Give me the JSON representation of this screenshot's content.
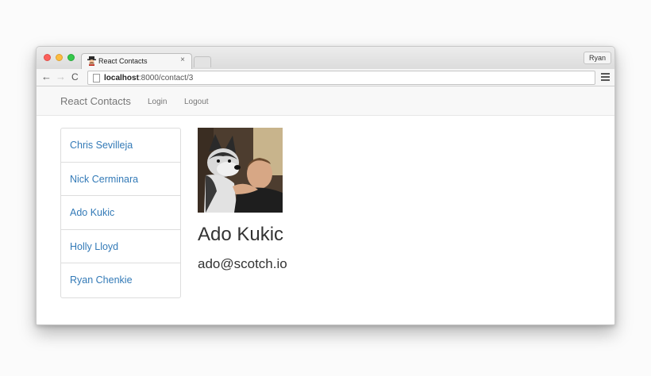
{
  "browser": {
    "tab_title": "React Contacts",
    "tab_close": "×",
    "profile_name": "Ryan",
    "url_host": "localhost",
    "url_path": ":8000/contact/3",
    "back_glyph": "←",
    "forward_glyph": "→",
    "reload_glyph": "C"
  },
  "navbar": {
    "brand": "React Contacts",
    "links": [
      "Login",
      "Logout"
    ]
  },
  "contacts": {
    "list": [
      "Chris Sevilleja",
      "Nick Cerminara",
      "Ado Kukic",
      "Holly Lloyd",
      "Ryan Chenkie"
    ]
  },
  "detail": {
    "name": "Ado Kukic",
    "email": "ado@scotch.io"
  },
  "colors": {
    "link": "#337ab7",
    "navbar_bg": "#f8f8f8",
    "text": "#333333"
  },
  "icons": [
    "favicon-icon",
    "close-icon",
    "back-arrow-icon",
    "forward-arrow-icon",
    "reload-icon",
    "page-icon",
    "menu-icon",
    "contact-photo"
  ]
}
